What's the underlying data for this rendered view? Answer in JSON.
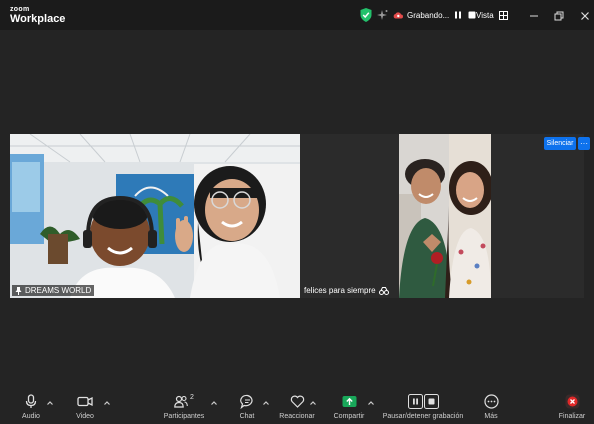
{
  "app": {
    "logo_small": "zoom",
    "logo_big": "Workplace"
  },
  "titlebar": {
    "recording_label": "Grabando...",
    "view_label": "Vista"
  },
  "participants": {
    "main_name": "DREAMS WORLD",
    "second_name": "felices para siempre"
  },
  "actions": {
    "mute_label": "Silenciar",
    "more_label": "···"
  },
  "toolbar": {
    "audio": "Audio",
    "video": "Video",
    "participants": "Participantes",
    "participants_count": "2",
    "chat": "Chat",
    "react": "Reaccionar",
    "share": "Compartir",
    "recording": "Pausar/detener grabación",
    "more": "Más",
    "end": "Finalizar"
  },
  "colors": {
    "accent": "#0e72ed",
    "share": "#19a85a",
    "end": "#e02828",
    "shield": "#23c16b"
  },
  "icons": [
    "zoom-logo",
    "shield-icon",
    "ai-sparkle-icon",
    "cloud-record-icon",
    "pause-icon",
    "stop-icon",
    "grid-icon",
    "minimize-icon",
    "restore-icon",
    "close-icon",
    "pin-icon",
    "microphone-icon",
    "camera-icon",
    "participants-icon",
    "chat-icon",
    "heart-icon",
    "share-icon",
    "more-icon",
    "end-icon",
    "chevron-up-icon"
  ]
}
